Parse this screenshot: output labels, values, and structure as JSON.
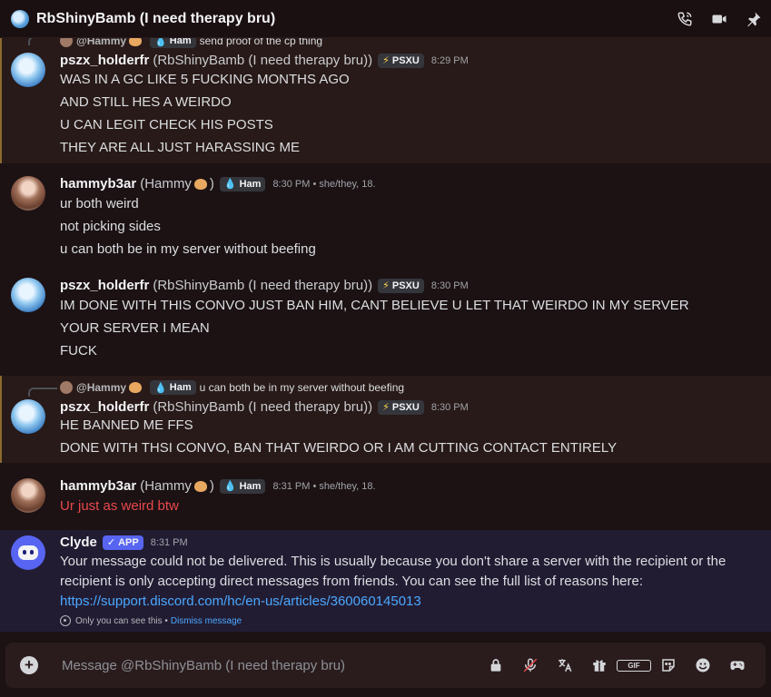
{
  "header": {
    "title": "RbShinyBamb (I need therapy bru)"
  },
  "top_reply": {
    "name": "@Hammy",
    "tag": "Ham",
    "text": "send proof of the cp thing"
  },
  "messages": [
    {
      "username": "pszx_holderfr",
      "nickname": "(RbShinyBamb (I need therapy bru))",
      "tag": "PSXU",
      "time": "8:29 PM",
      "lines": [
        "WAS IN A GC LIKE 5 FUCKING MONTHS AGO",
        "AND STILL HES A WEIRDO",
        "U CAN LEGIT CHECK HIS POSTS",
        "THEY ARE ALL JUST HARASSING ME"
      ]
    },
    {
      "username": "hammyb3ar",
      "nickname": "(Hammy",
      "nick_close": ")",
      "tag": "Ham",
      "time": "8:30 PM • she/they, 18.",
      "lines": [
        "ur both weird",
        "not picking sides",
        "u can both be in my server without beefing"
      ]
    },
    {
      "username": "pszx_holderfr",
      "nickname": "(RbShinyBamb (I need therapy bru))",
      "tag": "PSXU",
      "time": "8:30 PM",
      "lines": [
        "IM DONE WITH THIS CONVO JUST BAN HIM, CANT BELIEVE U LET THAT WEIRDO IN MY SERVER",
        "YOUR SERVER I MEAN",
        "FUCK"
      ]
    },
    {
      "reply": {
        "name": "@Hammy",
        "tag": "Ham",
        "text": "u can both be in my server without beefing"
      },
      "username": "pszx_holderfr",
      "nickname": "(RbShinyBamb (I need therapy bru))",
      "tag": "PSXU",
      "time": "8:30 PM",
      "lines": [
        "HE BANNED ME FFS",
        "DONE WITH THSI CONVO, BAN THAT WEIRDO OR I AM CUTTING CONTACT ENTIRELY"
      ]
    },
    {
      "username": "hammyb3ar",
      "nickname": "(Hammy",
      "nick_close": ")",
      "tag": "Ham",
      "time": "8:31 PM • she/they, 18.",
      "lines": [
        "Ur just as weird btw"
      ]
    },
    {
      "username": "Clyde",
      "tag": "APP",
      "time": "8:31 PM",
      "lines": [
        "Your message could not be delivered. This is usually because you don't share a server with the recipient or the",
        "recipient is only accepting direct messages from friends. You can see the full list of reasons here:"
      ],
      "link": "https://support.discord.com/hc/en-us/articles/360060145013",
      "ephemeral": "Only you can see this •",
      "dismiss": "Dismiss message"
    }
  ],
  "composer": {
    "placeholder": "Message @RbShinyBamb (I need therapy bru)",
    "gif_label": "GIF"
  },
  "colors": {
    "accent": "#5865f2",
    "link": "#4aa8ff",
    "danger": "#e9484c",
    "mention_highlight": "#281a18"
  }
}
